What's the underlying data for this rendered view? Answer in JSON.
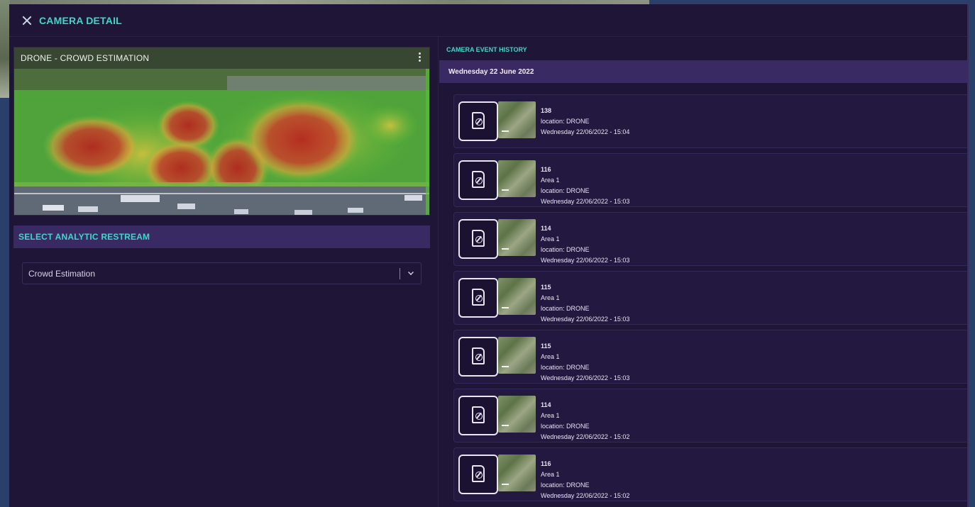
{
  "modal": {
    "title": "CAMERA DETAIL"
  },
  "video": {
    "title": "DRONE - CROWD ESTIMATION"
  },
  "analytic": {
    "label": "SELECT ANALYTIC RESTREAM",
    "selected": "Crowd Estimation"
  },
  "history": {
    "label": "CAMERA EVENT HISTORY",
    "date": "Wednesday 22 June 2022",
    "events": [
      {
        "id": "138",
        "lines": [
          "location: DRONE",
          "Wednesday 22/06/2022 - 15:04"
        ]
      },
      {
        "id": "116",
        "lines": [
          "Area 1",
          "location: DRONE",
          "Wednesday 22/06/2022 - 15:03"
        ]
      },
      {
        "id": "114",
        "lines": [
          "Area 1",
          "location: DRONE",
          "Wednesday 22/06/2022 - 15:03"
        ]
      },
      {
        "id": "115",
        "lines": [
          "Area 1",
          "location: DRONE",
          "Wednesday 22/06/2022 - 15:03"
        ]
      },
      {
        "id": "115",
        "lines": [
          "Area 1",
          "location: DRONE",
          "Wednesday 22/06/2022 - 15:03"
        ]
      },
      {
        "id": "114",
        "lines": [
          "Area 1",
          "location: DRONE",
          "Wednesday 22/06/2022 - 15:02"
        ]
      },
      {
        "id": "116",
        "lines": [
          "Area 1",
          "location: DRONE",
          "Wednesday 22/06/2022 - 15:02"
        ]
      }
    ]
  },
  "icons": {
    "close": "close-icon",
    "menu": "kebab-icon",
    "dropdown": "chevron-down-icon",
    "event_document": "document-icon"
  },
  "colors": {
    "accent": "#3fd7c8",
    "panel_bg": "#1f1536",
    "header_bar": "#3a2a63"
  }
}
